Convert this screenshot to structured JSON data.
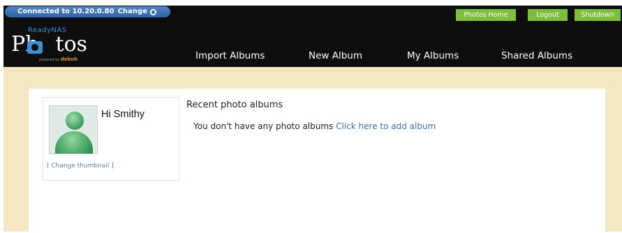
{
  "connection": {
    "status_label": "Connected to 10.20.0.80",
    "change_label": "Change"
  },
  "top_buttons": {
    "photos_home": "Photos Home",
    "logout": "Logout",
    "shutdown": "Shutdown"
  },
  "logo": {
    "brand": "ReadyNAS",
    "title_left": "Ph",
    "title_right": "tos",
    "powered_prefix": "powered by",
    "powered_brand": "dekoh"
  },
  "nav": {
    "import_albums": "Import Albums",
    "new_album": "New Album",
    "my_albums": "My Albums",
    "shared_albums": "Shared Albums"
  },
  "profile": {
    "greeting": "Hi Smithy",
    "change_thumbnail": "[ Change thumbnail ]"
  },
  "albums": {
    "title": "Recent photo albums",
    "empty_message": "You don't have any photo albums",
    "add_link": "Click here to add album"
  },
  "colors": {
    "topbar": "#0e0e0e",
    "connection_pill": "#2d64a8",
    "green_button": "#7bbf3a",
    "band": "#f3e8c2",
    "link": "#3d6fb0"
  }
}
